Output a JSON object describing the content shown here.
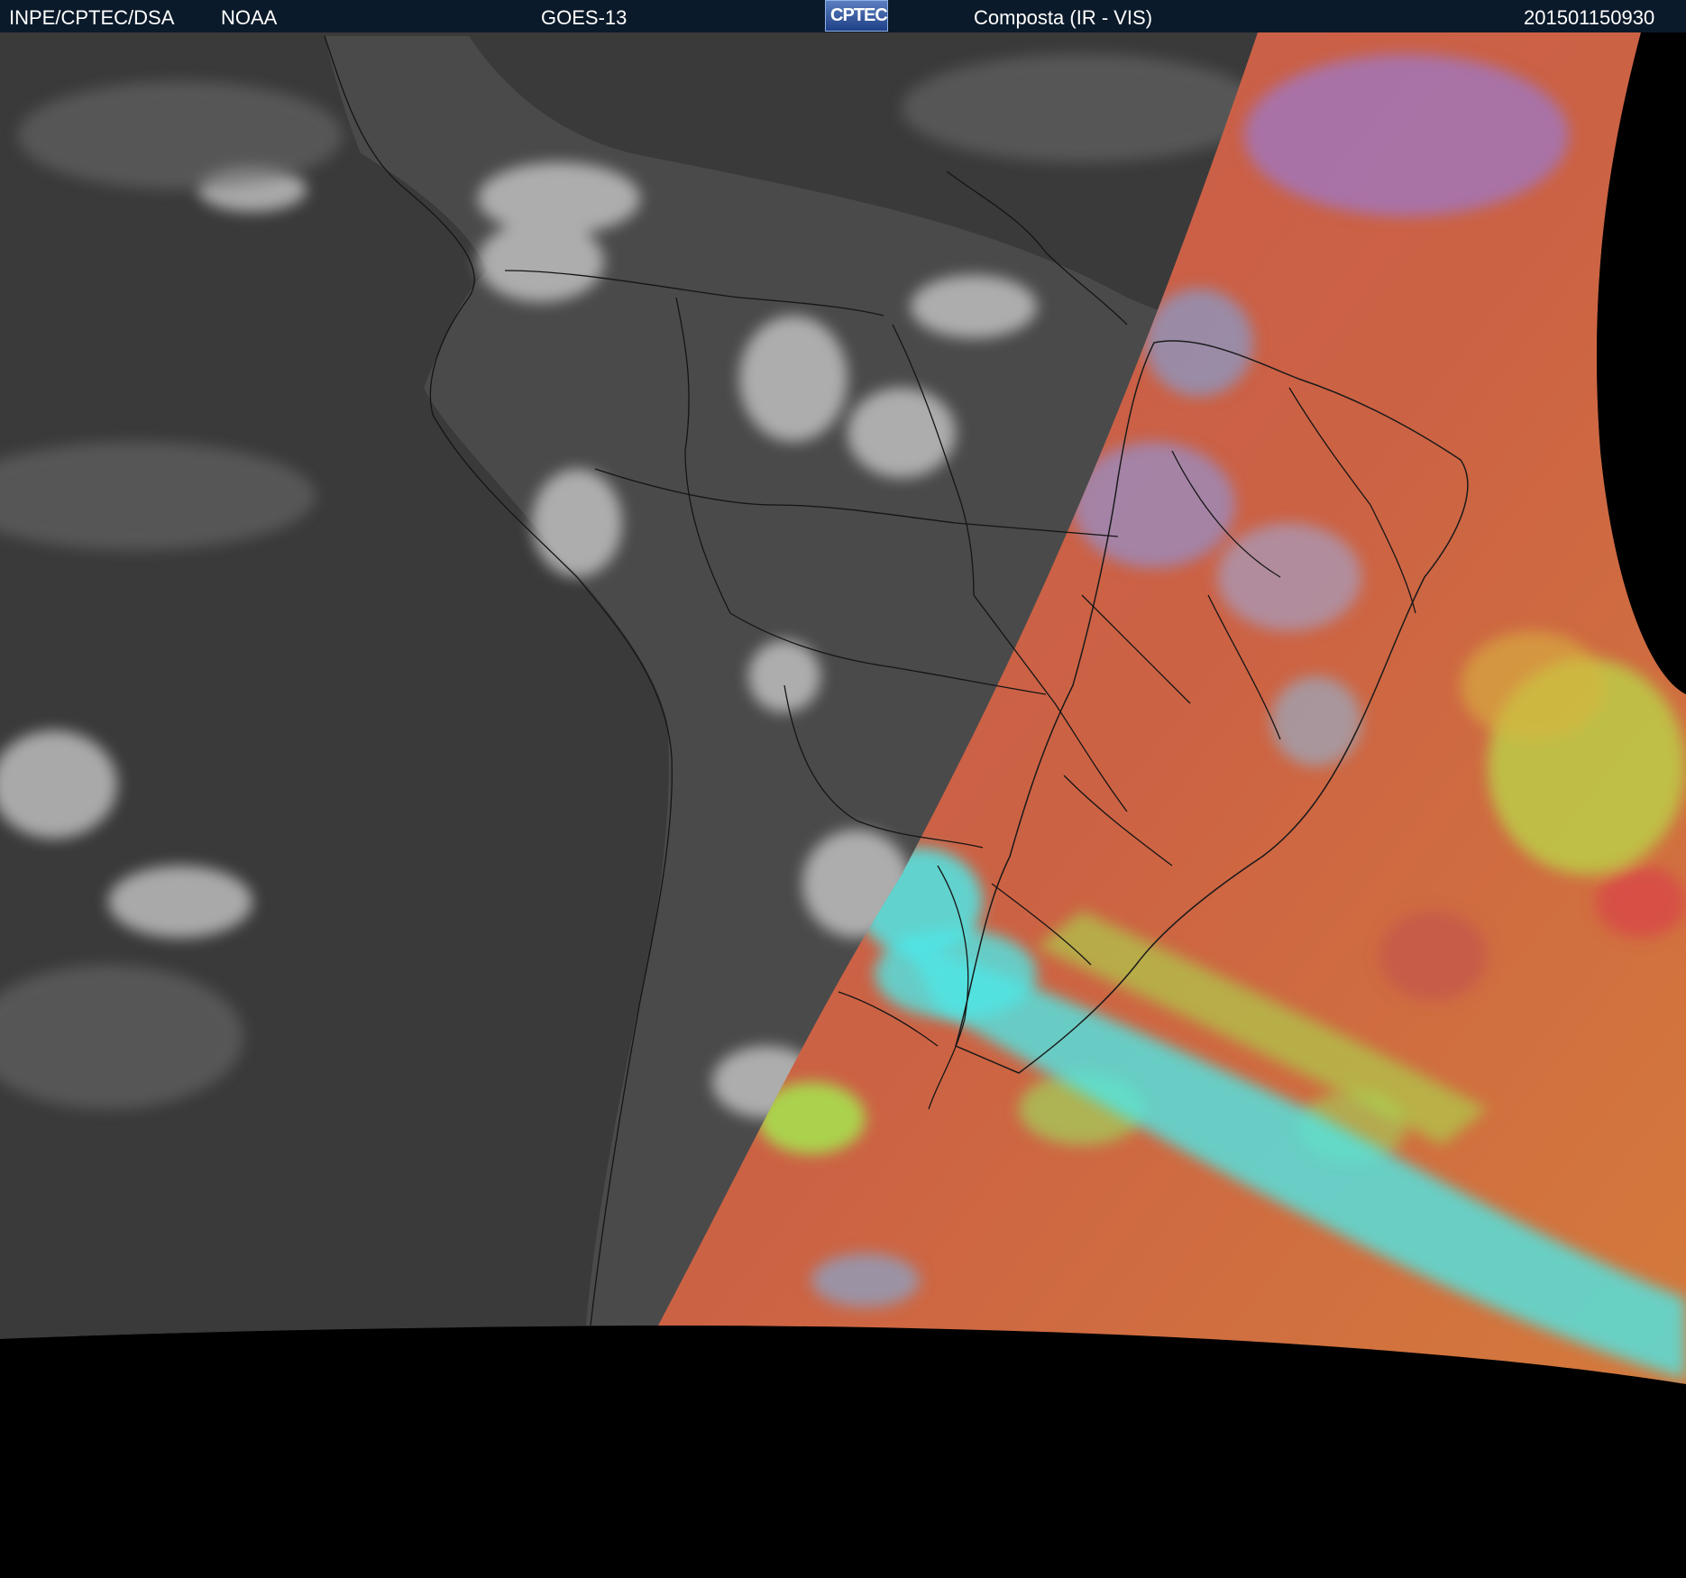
{
  "header": {
    "institution": "INPE/CPTEC/DSA",
    "agency": "NOAA",
    "satellite": "GOES-13",
    "logo_text": "CPTEC",
    "product": "Composta (IR - VIS)",
    "timestamp": "201501150930"
  },
  "colors": {
    "header_bg": "#0b1a2a",
    "ir_ocean": "#3a3a3a",
    "land_dark": "#4a4a4a",
    "cloud_white": "#dcdcdc",
    "vis_red": "#c4584a",
    "vis_orange": "#d47a3c",
    "vis_cyan": "#4fe6e6",
    "vis_green": "#a6e64f",
    "vis_blue": "#7a7ae6",
    "space": "#000000"
  }
}
